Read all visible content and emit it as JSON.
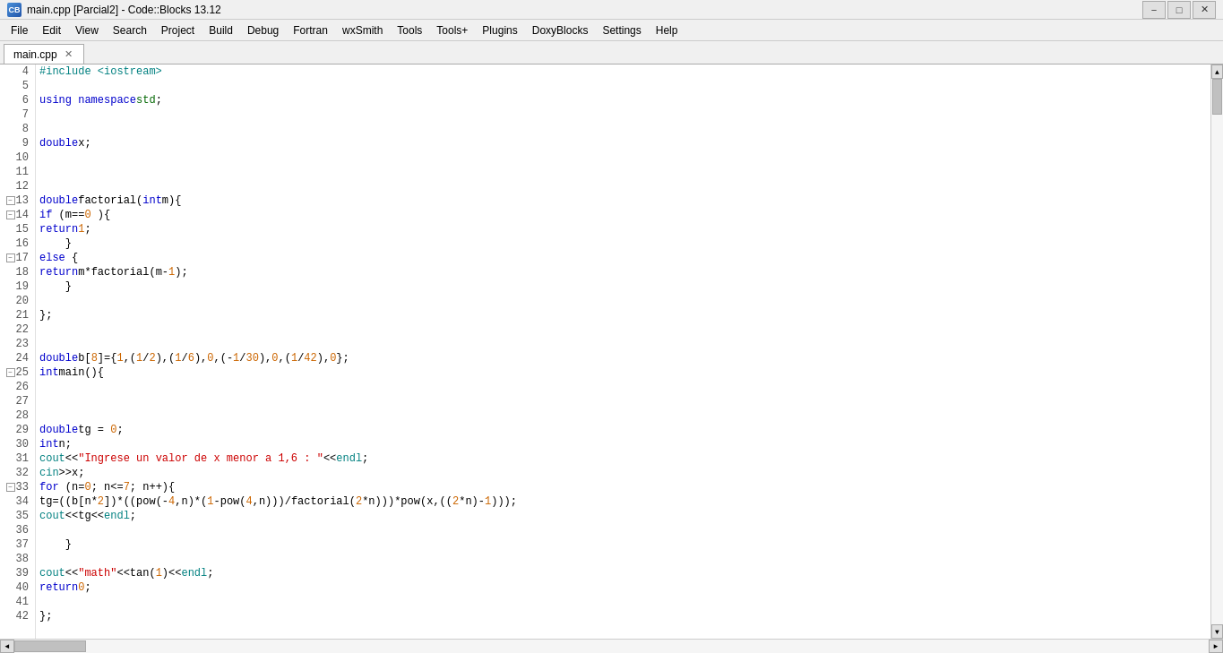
{
  "window": {
    "title": "main.cpp [Parcial2] - Code::Blocks 13.12",
    "icon": "CB"
  },
  "titlebar": {
    "minimize_label": "−",
    "maximize_label": "□",
    "close_label": "✕"
  },
  "menu": {
    "items": [
      "File",
      "Edit",
      "View",
      "Search",
      "Project",
      "Build",
      "Debug",
      "Fortran",
      "wxSmith",
      "Tools",
      "Tools+",
      "Plugins",
      "DoxyBlocks",
      "Settings",
      "Help"
    ]
  },
  "tab": {
    "label": "main.cpp",
    "close": "✕"
  },
  "lines": [
    {
      "num": 4,
      "fold": false,
      "code": "#include <iostream>",
      "type": "preproc"
    },
    {
      "num": 5,
      "fold": false,
      "code": "",
      "type": "plain"
    },
    {
      "num": 6,
      "fold": false,
      "code": "using namespace std;",
      "type": "kw"
    },
    {
      "num": 7,
      "fold": false,
      "code": "",
      "type": "plain"
    },
    {
      "num": 8,
      "fold": false,
      "code": "",
      "type": "plain"
    },
    {
      "num": 9,
      "fold": false,
      "code": "double x;",
      "type": "plain"
    },
    {
      "num": 10,
      "fold": false,
      "code": "",
      "type": "plain"
    },
    {
      "num": 11,
      "fold": false,
      "code": "",
      "type": "plain"
    },
    {
      "num": 12,
      "fold": false,
      "code": "",
      "type": "plain"
    },
    {
      "num": 13,
      "fold": true,
      "code": "double factorial(int m){",
      "type": "func_decl",
      "fold_open": true
    },
    {
      "num": 14,
      "fold": true,
      "code": "    if (m==0 ){",
      "type": "if_line",
      "fold_open": true
    },
    {
      "num": 15,
      "fold": false,
      "code": "        return 1;",
      "type": "return"
    },
    {
      "num": 16,
      "fold": false,
      "code": "    }",
      "type": "plain"
    },
    {
      "num": 17,
      "fold": true,
      "code": "    else {",
      "type": "else_line",
      "fold_open": true
    },
    {
      "num": 18,
      "fold": false,
      "code": "        return m*factorial(m-1);",
      "type": "return"
    },
    {
      "num": 19,
      "fold": false,
      "code": "    }",
      "type": "plain"
    },
    {
      "num": 20,
      "fold": false,
      "code": "",
      "type": "plain"
    },
    {
      "num": 21,
      "fold": false,
      "code": "};",
      "type": "plain"
    },
    {
      "num": 22,
      "fold": false,
      "code": "",
      "type": "plain"
    },
    {
      "num": 23,
      "fold": false,
      "code": "",
      "type": "plain"
    },
    {
      "num": 24,
      "fold": false,
      "code": "    double b[8]={1,(1/2),(1/6),0,(-1/30),0,(1/42),0};",
      "type": "array_decl"
    },
    {
      "num": 25,
      "fold": true,
      "code": "int main(){",
      "type": "main_decl",
      "fold_open": true
    },
    {
      "num": 26,
      "fold": false,
      "code": "",
      "type": "plain"
    },
    {
      "num": 27,
      "fold": false,
      "code": "",
      "type": "plain"
    },
    {
      "num": 28,
      "fold": false,
      "code": "",
      "type": "plain"
    },
    {
      "num": 29,
      "fold": false,
      "code": "    double tg = 0;",
      "type": "plain"
    },
    {
      "num": 30,
      "fold": false,
      "code": "    int n;",
      "type": "plain"
    },
    {
      "num": 31,
      "fold": false,
      "code": "        cout<<\"Ingrese un valor de x menor a 1,6 : \"<<endl;",
      "type": "cout"
    },
    {
      "num": 32,
      "fold": false,
      "code": "        cin>>x;",
      "type": "cin"
    },
    {
      "num": 33,
      "fold": true,
      "code": "        for (n=0; n<=7; n++){",
      "type": "for_line",
      "fold_open": true
    },
    {
      "num": 34,
      "fold": false,
      "code": "            tg=((b[n*2])*((pow(-4,n)*(1-pow(4,n)))/factorial(2*n))*pow(x,((2*n)-1)));",
      "type": "complex"
    },
    {
      "num": 35,
      "fold": false,
      "code": "            cout<<tg<<endl;",
      "type": "cout"
    },
    {
      "num": 36,
      "fold": false,
      "code": "",
      "type": "plain"
    },
    {
      "num": 37,
      "fold": false,
      "code": "    }",
      "type": "plain"
    },
    {
      "num": 38,
      "fold": false,
      "code": "",
      "type": "plain"
    },
    {
      "num": 39,
      "fold": false,
      "code": "        cout<<\"math\"<<tan(1)<<endl;",
      "type": "cout"
    },
    {
      "num": 40,
      "fold": false,
      "code": "    return 0;",
      "type": "return"
    },
    {
      "num": 41,
      "fold": false,
      "code": "",
      "type": "plain"
    },
    {
      "num": 42,
      "fold": false,
      "code": "};",
      "type": "plain"
    }
  ]
}
